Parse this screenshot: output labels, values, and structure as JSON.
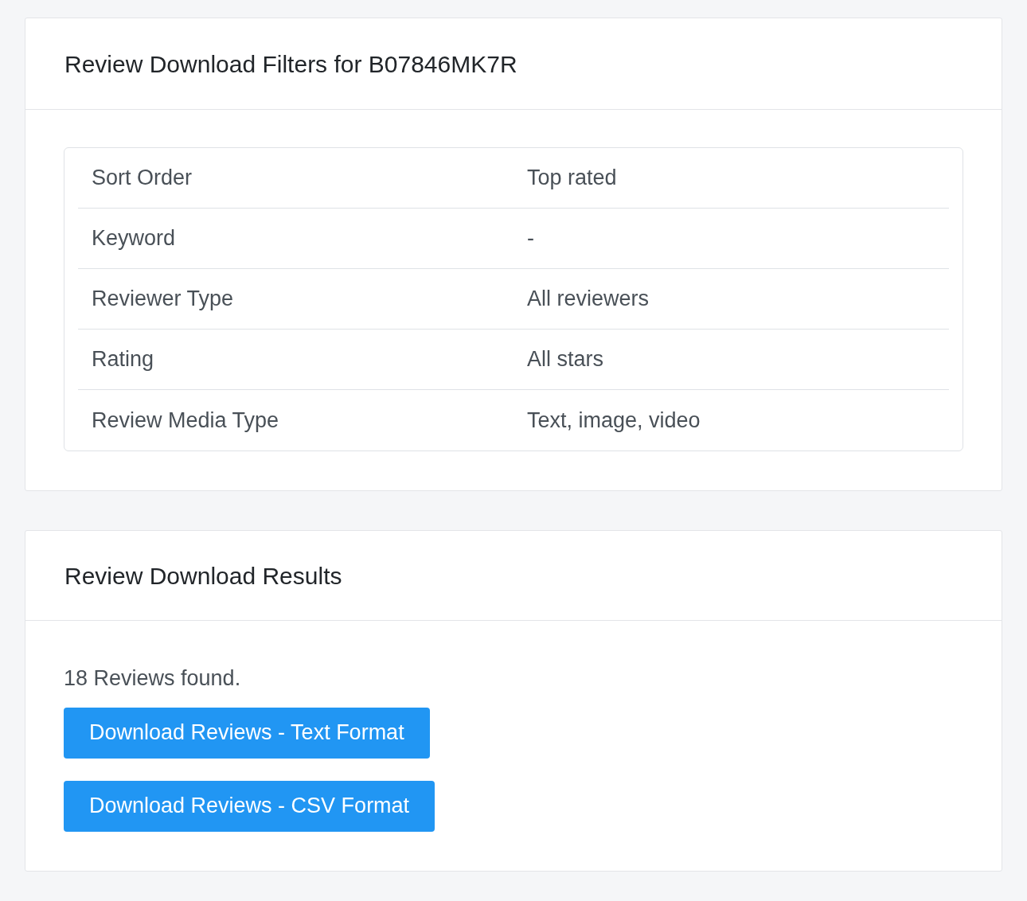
{
  "filters_card": {
    "title": "Review Download Filters for B07846MK7R",
    "rows": [
      {
        "label": "Sort Order",
        "value": "Top rated"
      },
      {
        "label": "Keyword",
        "value": "-"
      },
      {
        "label": "Reviewer Type",
        "value": "All reviewers"
      },
      {
        "label": "Rating",
        "value": "All stars"
      },
      {
        "label": "Review Media Type",
        "value": "Text, image, video"
      }
    ]
  },
  "results_card": {
    "title": "Review Download Results",
    "summary": "18 Reviews found.",
    "buttons": [
      "Download Reviews - Text Format",
      "Download Reviews - CSV Format"
    ]
  }
}
